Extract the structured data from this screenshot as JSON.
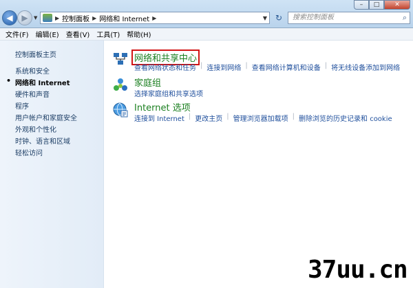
{
  "address_bar": {
    "crumbs": [
      "控制面板",
      "网络和 Internet"
    ],
    "search_placeholder": "搜索控制面板"
  },
  "menu": [
    "文件(F)",
    "编辑(E)",
    "查看(V)",
    "工具(T)",
    "帮助(H)"
  ],
  "sidebar": {
    "home": "控制面板主页",
    "items": [
      {
        "label": "系统和安全",
        "current": false
      },
      {
        "label": "网络和 Internet",
        "current": true
      },
      {
        "label": "硬件和声音",
        "current": false
      },
      {
        "label": "程序",
        "current": false
      },
      {
        "label": "用户帐户和家庭安全",
        "current": false
      },
      {
        "label": "外观和个性化",
        "current": false
      },
      {
        "label": "时钟、语言和区域",
        "current": false
      },
      {
        "label": "轻松访问",
        "current": false
      }
    ]
  },
  "categories": [
    {
      "title": "网络和共享中心",
      "highlighted": true,
      "links": [
        "查看网络状态和任务",
        "连接到网络",
        "查看网络计算机和设备",
        "将无线设备添加到网络"
      ]
    },
    {
      "title": "家庭组",
      "highlighted": false,
      "links": [
        "选择家庭组和共享选项"
      ]
    },
    {
      "title": "Internet 选项",
      "highlighted": false,
      "links": [
        "连接到 Internet",
        "更改主页",
        "管理浏览器加载项",
        "删除浏览的历史记录和 cookie"
      ]
    }
  ],
  "watermark": "37uu.cn",
  "colors": {
    "category_title": "#1a7f1f",
    "link": "#1f4f9c",
    "highlight_border": "#d21414"
  }
}
